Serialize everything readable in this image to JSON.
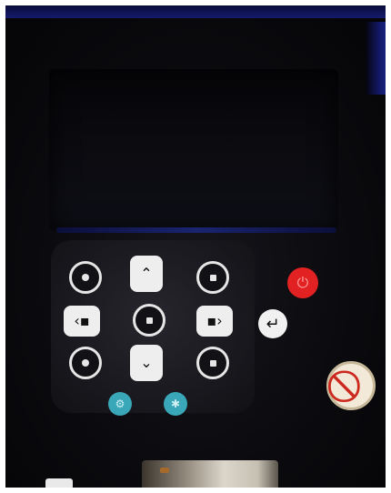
{
  "photo": {
    "subject": "handheld device keypad",
    "background_color": "#050508",
    "accent_blue": "#141a6a"
  },
  "keypad": {
    "keys": [
      {
        "name": "key-1",
        "icon": "dot-ring-icon"
      },
      {
        "name": "key-up",
        "icon": "chevron-up-icon"
      },
      {
        "name": "key-3",
        "icon": "square-ring-icon"
      },
      {
        "name": "key-left",
        "icon": "chevron-left-icon"
      },
      {
        "name": "key-center",
        "icon": "square-ring-icon"
      },
      {
        "name": "key-right",
        "icon": "chevron-right-icon"
      },
      {
        "name": "key-7",
        "icon": "dot-ring-icon"
      },
      {
        "name": "key-down",
        "icon": "chevron-down-icon"
      },
      {
        "name": "key-9",
        "icon": "square-ring-icon"
      }
    ],
    "function_keys": [
      {
        "name": "power",
        "icon": "power-icon",
        "color": "#e22222"
      },
      {
        "name": "enter",
        "icon": "return-arrow-icon",
        "color": "#f1f1f1"
      },
      {
        "name": "teal-left",
        "icon": "gear-icon",
        "color": "#3aa7b8"
      },
      {
        "name": "teal-right",
        "icon": "asterisk-icon",
        "color": "#3aa7b8"
      }
    ],
    "sticker": {
      "icon": "no-sign-icon",
      "color": "#cc2a1e"
    }
  }
}
